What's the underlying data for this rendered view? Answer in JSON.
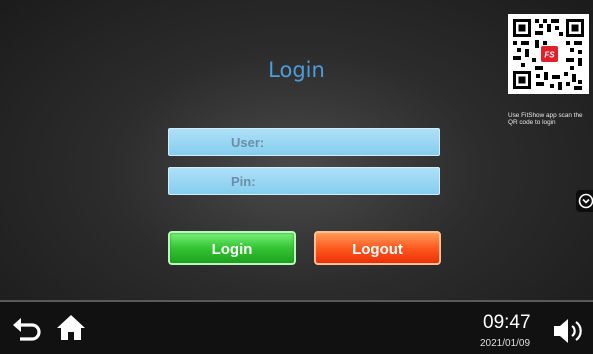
{
  "login": {
    "title": "Login",
    "user_placeholder": "User:",
    "pin_placeholder": "Pin:",
    "login_button": "Login",
    "logout_button": "Logout"
  },
  "qr": {
    "badge": "FS",
    "caption": "Use FitShow app scan the QR code to login"
  },
  "status": {
    "time": "09:47",
    "date": "2021/01/09"
  },
  "icons": {
    "back": "back-arrow-icon",
    "home": "home-icon",
    "volume": "volume-icon",
    "toggle": "chevron-down-icon"
  },
  "colors": {
    "title": "#4a9edb",
    "field": "#9ed9f5",
    "login_button": "#2ec42e",
    "logout_button": "#ff5a1e"
  }
}
